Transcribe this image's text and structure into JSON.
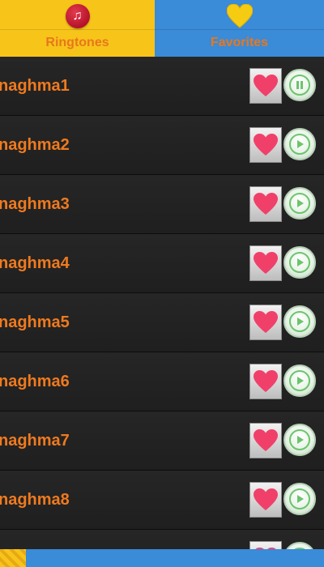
{
  "tabs": {
    "ringtones": {
      "label": "Ringtones",
      "icon": "music-note-icon",
      "color": "#f7c41a"
    },
    "favorites": {
      "label": "Favorites",
      "icon": "heart-icon",
      "color": "#3a8bd8"
    }
  },
  "ringtones": [
    {
      "name": "naghma1",
      "state": "playing"
    },
    {
      "name": "naghma2",
      "state": "stopped"
    },
    {
      "name": "naghma3",
      "state": "stopped"
    },
    {
      "name": "naghma4",
      "state": "stopped"
    },
    {
      "name": "naghma5",
      "state": "stopped"
    },
    {
      "name": "naghma6",
      "state": "stopped"
    },
    {
      "name": "naghma7",
      "state": "stopped"
    },
    {
      "name": "naghma8",
      "state": "stopped"
    },
    {
      "name": "",
      "state": "stopped"
    }
  ],
  "colors": {
    "accent_text": "#ef7a1f",
    "heart": "#f0406a",
    "play_green": "#6cc46c"
  }
}
